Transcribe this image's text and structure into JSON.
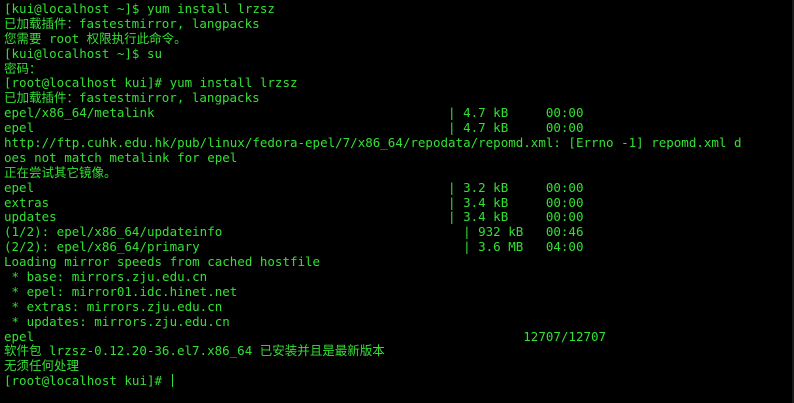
{
  "terminal": {
    "lines": [
      "[kui@localhost ~]$ yum install lrzsz",
      "已加载插件：fastestmirror, langpacks",
      "您需要 root 权限执行此命令。",
      "[kui@localhost ~]$ su",
      "密码：",
      "[root@localhost kui]# yum install lrzsz",
      "已加载插件：fastestmirror, langpacks",
      "epel/x86_64/metalink                                       | 4.7 kB     00:00",
      "epel                                                       | 4.7 kB     00:00",
      "http://ftp.cuhk.edu.hk/pub/linux/fedora-epel/7/x86_64/repodata/repomd.xml: [Errno -1] repomd.xml d",
      "oes not match metalink for epel",
      "正在尝试其它镜像。",
      "epel                                                       | 3.2 kB     00:00",
      "extras                                                     | 3.4 kB     00:00",
      "updates                                                    | 3.4 kB     00:00",
      "(1/2): epel/x86_64/updateinfo                                | 932 kB   00:46",
      "(2/2): epel/x86_64/primary                                   | 3.6 MB   04:00",
      "Loading mirror speeds from cached hostfile",
      " * base: mirrors.zju.edu.cn",
      " * epel: mirror01.idc.hinet.net",
      " * extras: mirrors.zju.edu.cn",
      " * updates: mirrors.zju.edu.cn",
      "epel                                                                 12707/12707",
      "软件包 lrzsz-0.12.20-36.el7.x86_64 已安装并且是最新版本",
      "无须任何处理",
      "[root@localhost kui]# "
    ]
  }
}
